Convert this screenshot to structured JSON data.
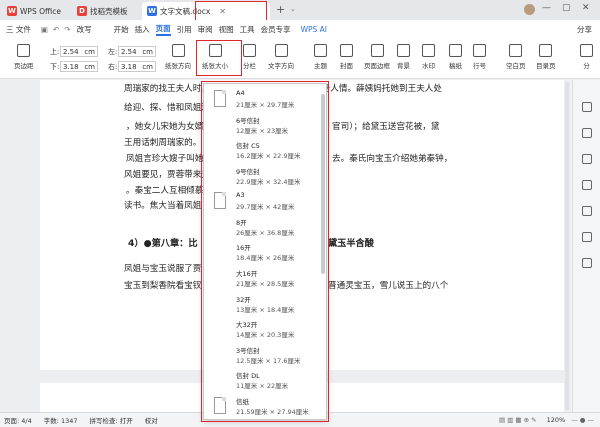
{
  "tabs": [
    {
      "label": "WPS Office",
      "logo": "W",
      "color": "#e8433a"
    },
    {
      "label": "找稻壳模板",
      "logo": "D",
      "color": "#e8433a"
    },
    {
      "label": "文字文稿.docx",
      "logo": "W",
      "color": "#2f6fe4"
    }
  ],
  "new_tab": "+",
  "menubar": {
    "file": "三 文件",
    "more": "改写",
    "items": [
      "开始",
      "插入",
      "页面",
      "引用",
      "审阅",
      "视图",
      "工具",
      "会员专享"
    ],
    "ai": "WPS AI",
    "share": "分享"
  },
  "ribbon": {
    "margins": "页边距",
    "top_label": "上:",
    "top_val": "2.54",
    "bottom_label": "下:",
    "bottom_val": "3.18",
    "left_label": "左:",
    "left_val": "2.54",
    "right_label": "右:",
    "right_val": "3.18",
    "unit": "cm",
    "orientation": "纸张方向",
    "size": "纸张大小",
    "columns": "分栏",
    "direction": "文字方向",
    "theme": "主题",
    "cover": "封面",
    "border": "页面边框",
    "background": "背景",
    "watermark": "水印",
    "draft": "稿纸",
    "linenum": "行号",
    "blank": "空白页",
    "toc": "目录页",
    "split": "分"
  },
  "doc": {
    "lines": [
      "周瑞家的找王夫人时，正遇着薛姨妈在与王夫人说家务人情。薛姨妈托她到王夫人处",
      "给迎、探、惜和凤姐送宫花，",
      "，她女儿宋她为女婿他小子",
      "王用话刺周瑞家的。",
      "凤姐言珍大嫂子叫她",
      "风姐要见，贾蓉带来见凤",
      "。秦宝二人互相倾慕",
      "读书。焦大当着凤姐",
      "凤姐与宝玉说服了贾",
      "宝玉到梨香院看宝钗"
    ],
    "right_fragments": [
      "官司）；给黛玉送宫花被，黛",
      "去。秦氏向宝玉介绍她弟秦钟，",
      "晋通灵宝玉，雪儿说玉上的八个"
    ],
    "heading_left": "4）●第八章：比",
    "heading_right": "黛玉半含酸"
  },
  "dropdown": {
    "items": [
      {
        "name": "A4",
        "dims": "21厘米 × 29.7厘米"
      },
      {
        "name": "6号信封",
        "dims": "12厘米 × 23厘米"
      },
      {
        "name": "信封 C5",
        "dims": "16.2厘米 × 22.9厘米"
      },
      {
        "name": "9号信封",
        "dims": "22.9厘米 × 32.4厘米"
      },
      {
        "name": "A3",
        "dims": "29.7厘米 × 42厘米"
      },
      {
        "name": "8开",
        "dims": "26厘米 × 36.8厘米"
      },
      {
        "name": "16开",
        "dims": "18.4厘米 × 26厘米"
      },
      {
        "name": "大16开",
        "dims": "21厘米 × 28.5厘米"
      },
      {
        "name": "32开",
        "dims": "13厘米 × 18.4厘米"
      },
      {
        "name": "大32开",
        "dims": "14厘米 × 20.3厘米"
      },
      {
        "name": "3号信封",
        "dims": "12.5厘米 × 17.6厘米"
      },
      {
        "name": "信封 DL",
        "dims": "11厘米 × 22厘米"
      },
      {
        "name": "信纸",
        "dims": "21.59厘米 × 27.94厘米"
      }
    ]
  },
  "status": {
    "page": "页面: 4/4",
    "words": "字数: 1347",
    "spell": "拼写检查: 打开",
    "proof": "校对",
    "zoom": "120%"
  },
  "colors": {
    "highlight": "#e0262a",
    "accent": "#2f6fe4"
  }
}
